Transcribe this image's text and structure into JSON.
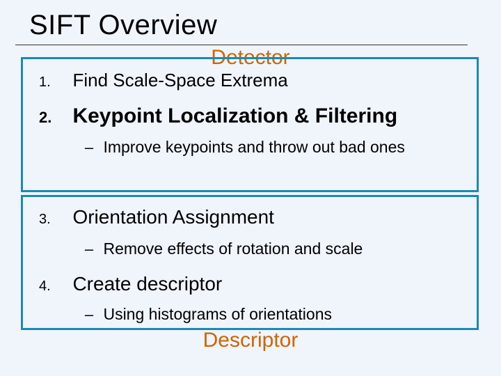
{
  "title": "SIFT Overview",
  "labels": {
    "detector": "Detector",
    "descriptor": "Descriptor"
  },
  "items": [
    {
      "num": "1.",
      "text": "Find Scale-Space Extrema"
    },
    {
      "num": "2.",
      "text": "Keypoint Localization & Filtering",
      "sub": "Improve keypoints and throw out bad ones"
    },
    {
      "num": "3.",
      "text": "Orientation Assignment",
      "sub": "Remove effects of rotation and scale"
    },
    {
      "num": "4.",
      "text": "Create descriptor",
      "sub": "Using histograms of orientations"
    }
  ],
  "dash": "–"
}
